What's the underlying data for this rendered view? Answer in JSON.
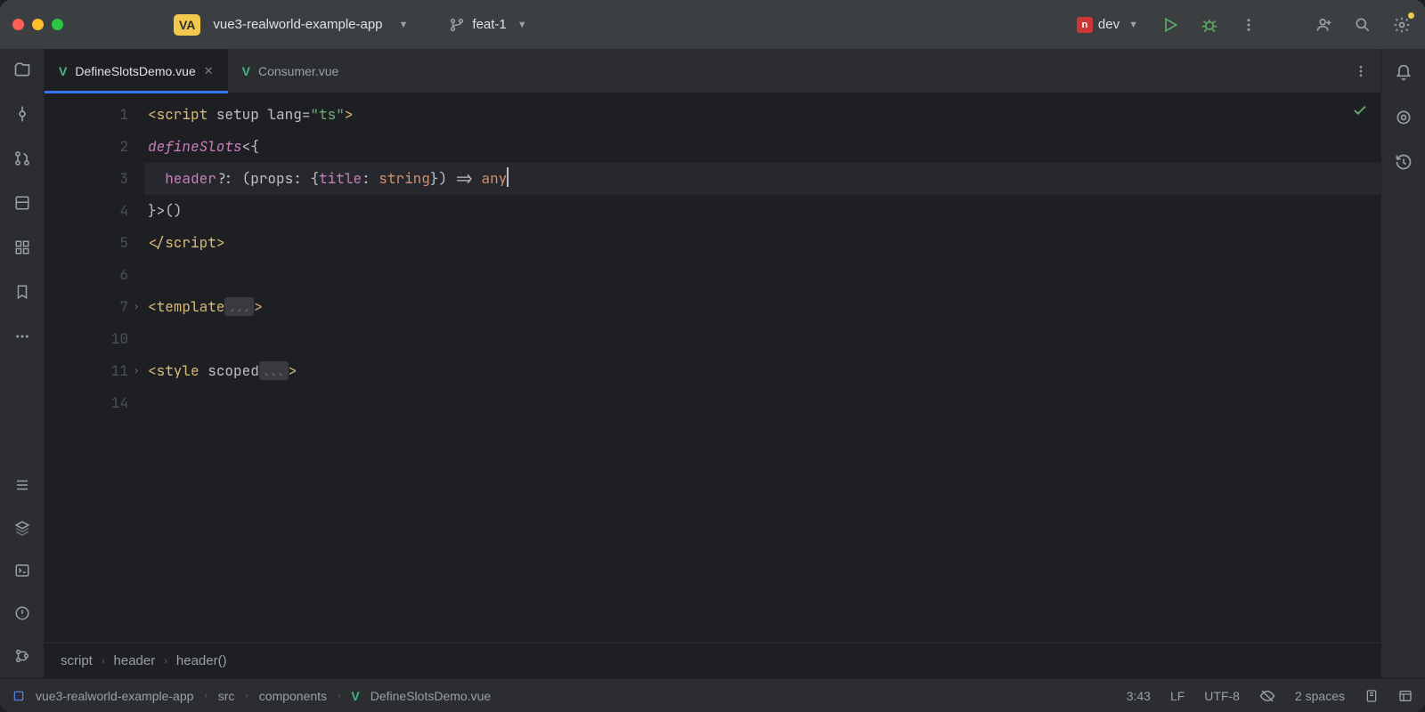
{
  "project": {
    "badge": "VA",
    "name": "vue3-realworld-example-app"
  },
  "branch": "feat-1",
  "run": {
    "config": "dev"
  },
  "tabs": [
    {
      "name": "DefineSlotsDemo.vue",
      "active": true
    },
    {
      "name": "Consumer.vue",
      "active": false
    }
  ],
  "gutter": [
    "1",
    "2",
    "3",
    "4",
    "5",
    "6",
    "7",
    "10",
    "11",
    "14"
  ],
  "folds": {
    "7": true,
    "11": true
  },
  "breadcrumbs": [
    "script",
    "header",
    "header()"
  ],
  "nav": {
    "project": "vue3-realworld-example-app",
    "path": [
      "src",
      "components"
    ],
    "file": "DefineSlotsDemo.vue"
  },
  "status": {
    "cursor": "3:43",
    "eol": "LF",
    "encoding": "UTF-8",
    "indent": "2 spaces"
  },
  "code": {
    "l1": {
      "open": "<",
      "tag": "script",
      "attrs": " setup lang=",
      "str": "\"ts\"",
      "close": ">"
    },
    "l2": {
      "fn": "defineSlots",
      "rest": "<{"
    },
    "l3": {
      "indent": "  ",
      "ident": "header",
      "a": "?: (",
      "p": "props",
      "b": ": {",
      "t": "title",
      "c": ": ",
      "kw1": "string",
      "d": "}) => ",
      "kw2": "any"
    },
    "l4": "}>()",
    "l5": {
      "open": "</",
      "tag": "script",
      "close": ">"
    },
    "l7": {
      "open": "<",
      "tag": "template",
      "fold": "...",
      "close": ">"
    },
    "l11": {
      "open": "<",
      "tag": "style",
      "attr": " scoped",
      "fold": "...",
      "close": ">"
    }
  }
}
